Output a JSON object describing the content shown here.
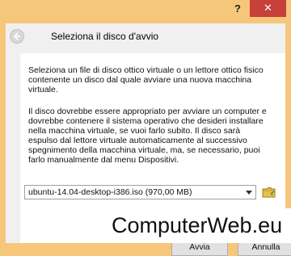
{
  "titlebar": {
    "help_label": "?",
    "close_label": "✕"
  },
  "header": {
    "title": "Seleziona il disco d'avvio"
  },
  "body": {
    "paragraph1": "Seleziona un file di disco ottico virtuale o un lettore ottico fisico contenente un disco dal quale avviare una nuova macchina virtuale.",
    "paragraph2": "Il disco dovrebbe essere appropriato per avviare un computer e dovrebbe contenere il sistema operativo che desideri installare nella macchina virtuale, se vuoi farlo subito. Il disco sarà espulso dal lettore virtuale automaticamente al successivo spegnimento della macchina virtuale, ma, se necessario, puoi farlo manualmente dal menu Dispositivi."
  },
  "disk_select": {
    "selected": "ubuntu-14.04-desktop-i386.iso (970,00 MB)"
  },
  "buttons": {
    "start": "Avvia",
    "cancel": "Annulla"
  },
  "watermark": "ComputerWeb.eu",
  "colors": {
    "frame": "#f6c77a",
    "close_button": "#c7403a",
    "dialog_bg": "#f0f0f0",
    "content_bg": "#ffffff"
  }
}
